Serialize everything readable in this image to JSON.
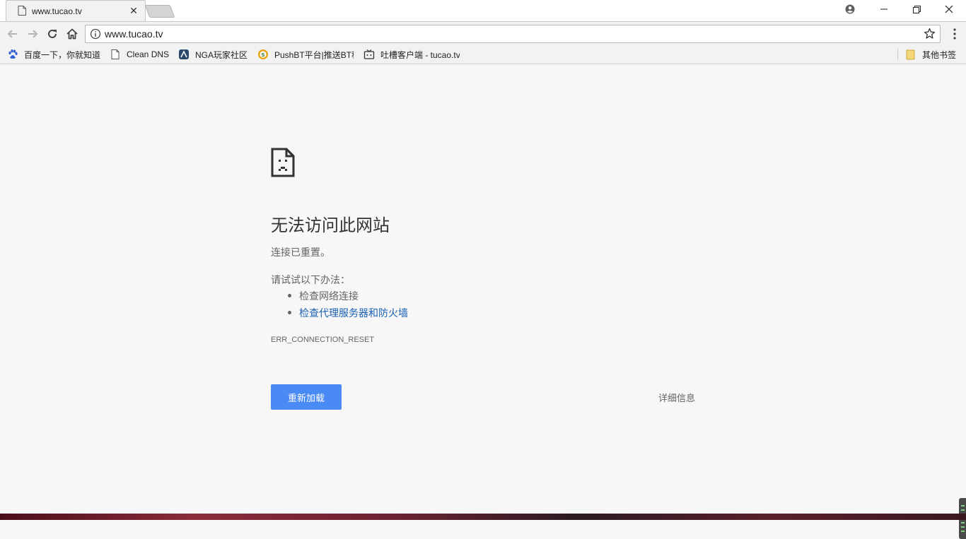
{
  "tab": {
    "title": "www.tucao.tv",
    "close_glyph": "✕"
  },
  "omnibox": {
    "url": "www.tucao.tv"
  },
  "bookmarks": {
    "items": [
      {
        "label": "百度一下，你就知道",
        "icon": "baidu-paw-icon"
      },
      {
        "label": "Clean DNS",
        "icon": "page-icon"
      },
      {
        "label": "NGA玩家社区",
        "icon": "nga-icon"
      },
      {
        "label": "PushBT平台|推送BT种",
        "icon": "pushbt-icon"
      },
      {
        "label": "吐槽客户端 - tucao.tv",
        "icon": "tv-icon"
      }
    ],
    "other": {
      "label": "其他书签",
      "icon": "folder-icon"
    }
  },
  "error": {
    "title": "无法访问此网站",
    "description": "连接已重置。",
    "try_label": "请试试以下办法：",
    "suggestions": [
      {
        "text": "检查网络连接",
        "link": false
      },
      {
        "text": "检查代理服务器和防火墙",
        "link": true
      }
    ],
    "code": "ERR_CONNECTION_RESET",
    "reload_label": "重新加载",
    "details_label": "详细信息"
  },
  "colors": {
    "accent": "#4a8af4",
    "link": "#1a5fb4",
    "page_bg": "#f7f7f7"
  }
}
